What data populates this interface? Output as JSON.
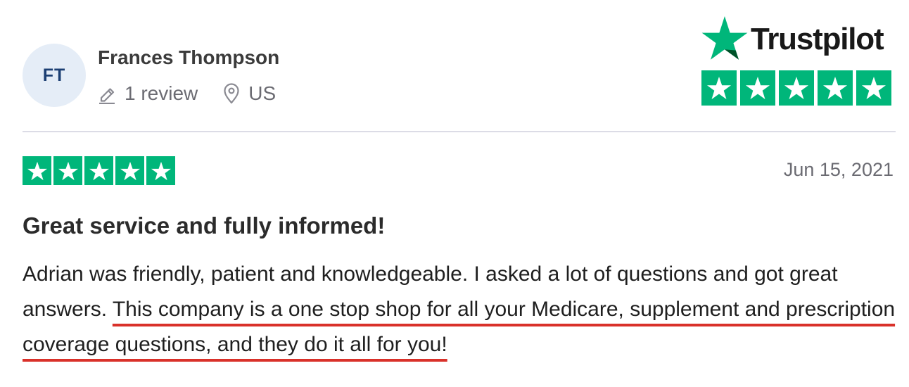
{
  "reviewer": {
    "initials": "FT",
    "name": "Frances Thompson",
    "review_count": "1 review",
    "country": "US",
    "review_count_icon": "pencil-icon",
    "country_icon": "location-pin-icon"
  },
  "brand": {
    "name": "Trustpilot",
    "logo_icon": "star-icon",
    "rating_stars": 5,
    "color": "#00b67a"
  },
  "review": {
    "rating_stars": 5,
    "date": "Jun 15, 2021",
    "title": "Great service and fully informed!",
    "body_plain": "Adrian was friendly, patient and knowledgeable. I asked a lot of questions and got great answers. ",
    "body_highlight": "This company is a one stop shop for all your Medicare, supplement and prescription coverage questions, and they do it all for you!",
    "highlight_color": "#d9312a"
  },
  "colors": {
    "star_green": "#00b67a",
    "avatar_bg": "#e5edf7",
    "avatar_text": "#1c3f73",
    "muted_text": "#6b6b72",
    "underline_red": "#d9312a"
  }
}
